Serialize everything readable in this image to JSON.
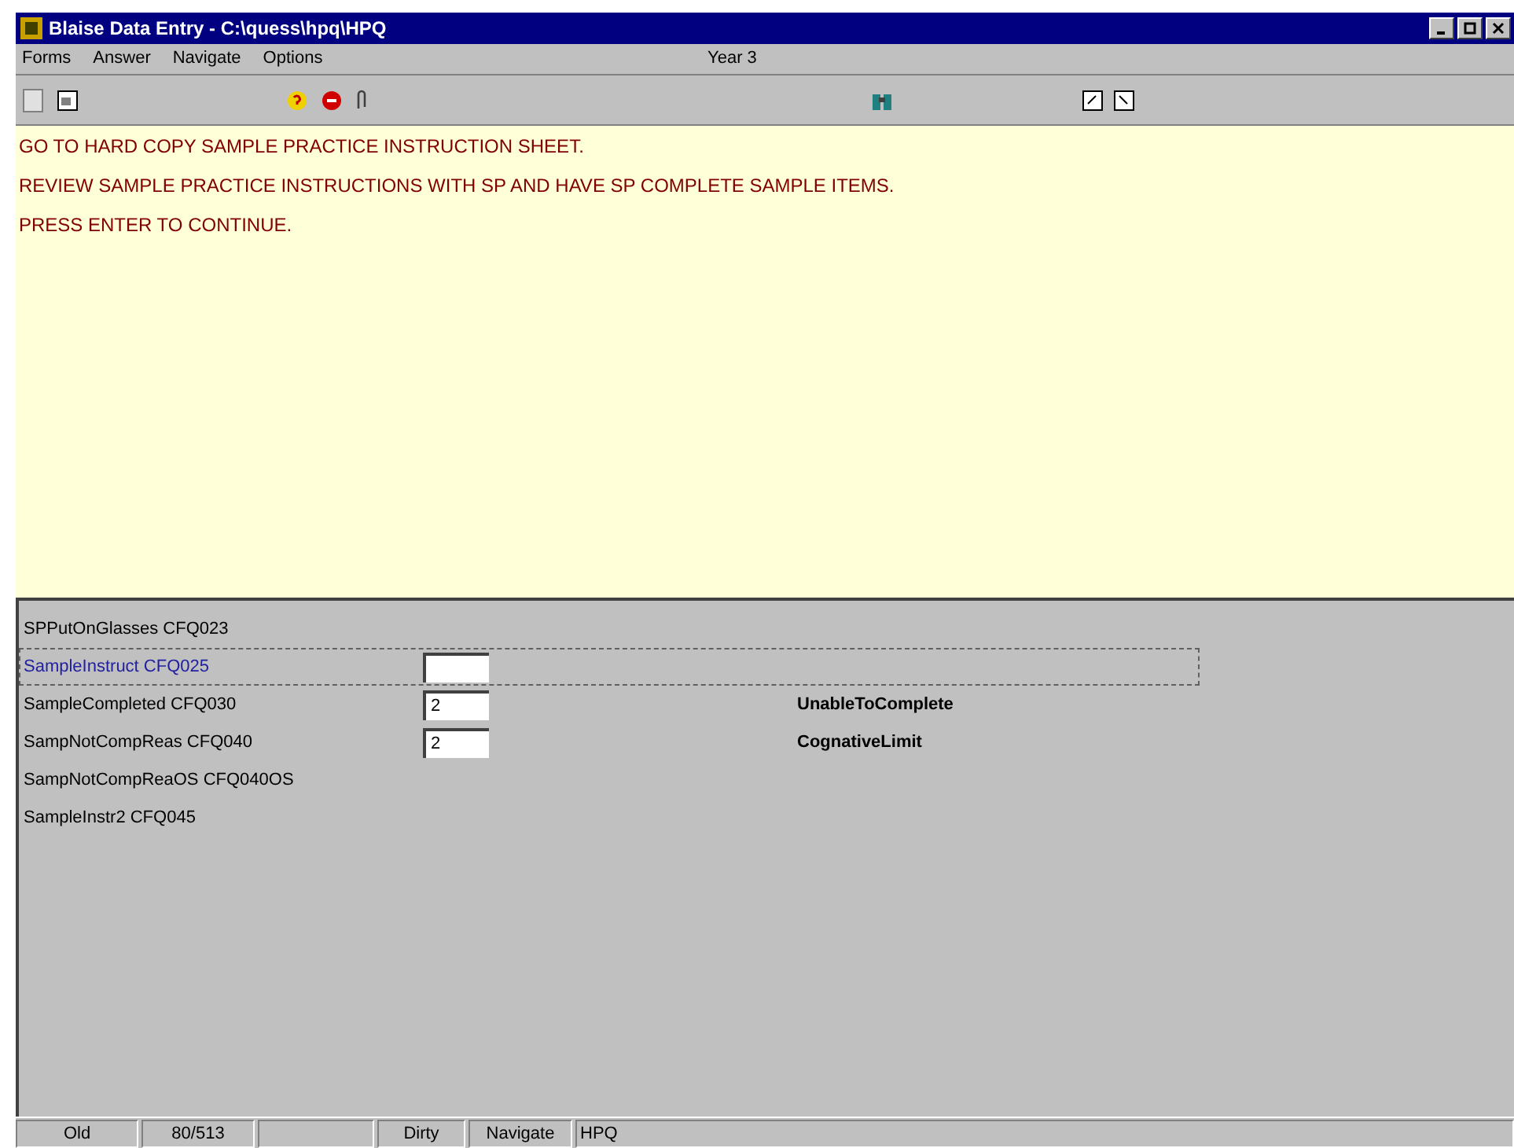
{
  "window": {
    "title": "Blaise Data Entry - C:\\quess\\hpq\\HPQ"
  },
  "menu": [
    {
      "label": "Forms"
    },
    {
      "label": "Answer"
    },
    {
      "label": "Navigate"
    },
    {
      "label": "Options"
    }
  ],
  "menu_caption": "Year 3",
  "instructions": [
    "GO TO HARD COPY SAMPLE PRACTICE INSTRUCTION SHEET.",
    "REVIEW SAMPLE PRACTICE INSTRUCTIONS WITH SP AND HAVE SP COMPLETE SAMPLE ITEMS.",
    "PRESS ENTER TO CONTINUE."
  ],
  "fields": [
    {
      "kind": "label",
      "label": "SPPutOnGlasses CFQ023",
      "selected": false
    },
    {
      "kind": "input",
      "label": "SampleInstruct CFQ025",
      "selected": true
    },
    {
      "kind": "input",
      "label": "SampleCompleted CFQ030",
      "value": "2",
      "answer": "UnableToComplete",
      "selected": false
    },
    {
      "kind": "input",
      "label": "SampNotCompReas CFQ040",
      "value": "2",
      "answer": "CognativeLimit",
      "selected": false
    },
    {
      "kind": "label",
      "label": "SampNotCompReaOS CFQ040OS",
      "selected": false
    },
    {
      "kind": "label",
      "label": "SampleInstr2 CFQ045",
      "selected": false
    }
  ],
  "status_bar": {
    "left": [
      "Old",
      "80/513"
    ],
    "right": [
      "Dirty",
      "Navigate",
      "HPQ"
    ]
  }
}
